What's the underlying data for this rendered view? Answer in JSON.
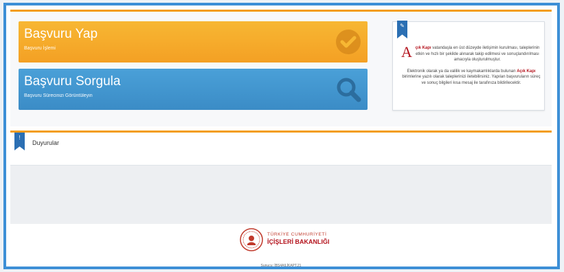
{
  "cards": {
    "apply": {
      "title": "Başvuru Yap",
      "subtitle": "Başvuru İşlemi",
      "icon": "check-circle-icon",
      "color": "#f4a024"
    },
    "query": {
      "title": "Başvuru Sorgula",
      "subtitle": "Başvuru Sürecinizi Görüntüleyin",
      "icon": "magnifier-icon",
      "color": "#3b8cc6"
    }
  },
  "info": {
    "bookmark_icon": "pencil-icon",
    "drop_cap": "A",
    "p1_highlight": "çık Kapı",
    "p1_rest": " vatandaşla en üst düzeyde iletişimin kurulması, taleplerinin etkin ve hızlı bir şekilde alınarak takip edilmesi ve sonuçlandırılması amacıyla oluşturulmuştur.",
    "p2_start": "Elektronik olarak ya da valilik ve kaymakamlıklarda bulunan ",
    "p2_highlight": "Açık Kapı",
    "p2_rest": " birimlerine yazılı olarak taleplerinizi iletebilirsiniz. Yapılan başvuruların süreç ve sonuç bilgileri kısa mesaj ile tarafınıza bildirilecektir."
  },
  "announcements": {
    "title": "Duyurular",
    "bookmark_icon": "exclamation-icon"
  },
  "footer": {
    "logo_line1": "TÜRKİYE CUMHURİYETİ",
    "logo_line2": "İÇİŞLERİ BAKANLIĞI",
    "server": "Sunucu: İBS4AILİKAPT.21"
  },
  "colors": {
    "accent_orange": "#f39c12",
    "frame_blue": "#3d8fd6",
    "brand_red": "#b4141e"
  }
}
